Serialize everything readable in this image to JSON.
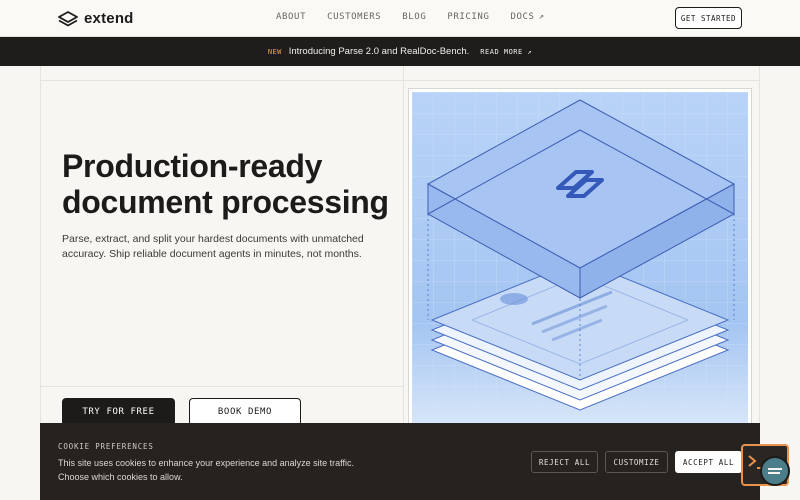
{
  "brand": {
    "name": "extend"
  },
  "nav": {
    "items": [
      {
        "label": "ABOUT"
      },
      {
        "label": "CUSTOMERS"
      },
      {
        "label": "BLOG"
      },
      {
        "label": "PRICING"
      },
      {
        "label": "DOCS",
        "arrow": "↗"
      }
    ],
    "cta": "GET STARTED"
  },
  "announcement": {
    "badge": "NEW",
    "message": "Introducing Parse 2.0 and RealDoc-Bench.",
    "link": "READ MORE ↗"
  },
  "hero": {
    "title_line1": "Production-ready",
    "title_line2": "document processing",
    "subtitle": "Parse, extract, and split your hardest documents with unmatched accuracy. Ship reliable document agents in minutes, not months.",
    "primary_button": "TRY FOR FREE",
    "secondary_button": "BOOK DEMO"
  },
  "cookie": {
    "title": "COOKIE PREFERENCES",
    "text": "This site uses cookies to enhance your experience and analyze site traffic. Choose which cookies to allow.",
    "reject": "REJECT ALL",
    "customize": "CUSTOMIZE",
    "accept": "ACCEPT ALL"
  },
  "colors": {
    "accent_orange": "#e9a34a",
    "illustration_blue": "#a9c8f5",
    "dark": "#1f1d1b"
  },
  "icons": [
    "logo-layers-icon",
    "external-arrow-icon",
    "chat-widget-icon"
  ]
}
